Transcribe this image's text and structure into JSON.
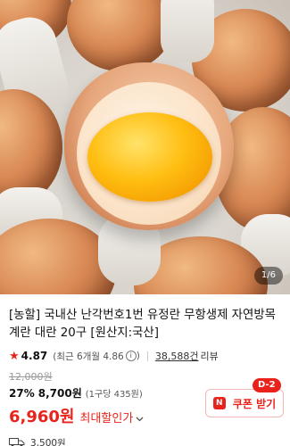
{
  "gallery": {
    "current": "1",
    "total": "6",
    "counter_text": "1/6"
  },
  "product": {
    "title": "[농할] 국내산 난각번호1번 유정란 무항생제 자연방목 계란 대란 20구 [원산지:국산]",
    "rating": "4.87",
    "rating_sub": "(최근 6개월 4.86",
    "rating_sub_close": ")",
    "review_count": "38,588건",
    "review_label": "리뷰"
  },
  "pricing": {
    "original_price": "12,000원",
    "discount_rate": "27%",
    "discounted_price": "8,700원",
    "unit_price": "(1구당 435원)",
    "final_price": "6,960원",
    "final_label": "최대할인가"
  },
  "coupon": {
    "badge": "D-2",
    "icon_text": "N",
    "label": "쿠폰 받기"
  },
  "delivery": {
    "fee": "3,500원"
  },
  "colors": {
    "accent": "#e8231b"
  },
  "icons": {
    "star": "star-icon",
    "info": "info-icon",
    "chevron": "chevron-down-icon",
    "coupon": "coupon-icon",
    "truck": "truck-icon"
  }
}
